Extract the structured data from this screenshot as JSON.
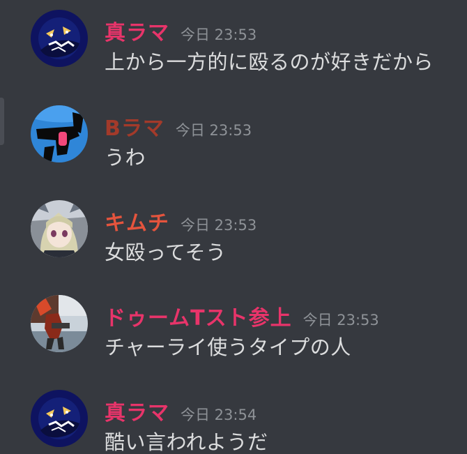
{
  "colors": {
    "background": "#36393f",
    "timestamp": "#8e9297",
    "message_text": "#dcddde",
    "name_pink": "#e8346a",
    "name_brown": "#a33a2a",
    "name_orange": "#e5543d"
  },
  "messages": [
    {
      "username": "真ラマ",
      "timestamp": "今日 23:53",
      "text": "上から一方的に殴るのが好きだから",
      "name_color": "#e8346a",
      "avatar_icon": "dark-blue-creature-avatar"
    },
    {
      "username": "Bラマ",
      "timestamp": "今日 23:53",
      "text": "うわ",
      "name_color": "#a33a2a",
      "avatar_icon": "blue-silhouette-avatar"
    },
    {
      "username": "キムチ",
      "timestamp": "今日 23:53",
      "text": "女殴ってそう",
      "name_color": "#e5543d",
      "avatar_icon": "anime-girl-avatar"
    },
    {
      "username": "ドゥームTスト参上",
      "timestamp": "今日 23:53",
      "text": "チャーライ使うタイプの人",
      "name_color": "#e8346a",
      "avatar_icon": "game-scene-avatar"
    },
    {
      "username": "真ラマ",
      "timestamp": "今日 23:54",
      "text": "酷い言われようだ",
      "name_color": "#e8346a",
      "avatar_icon": "dark-blue-creature-avatar"
    }
  ]
}
